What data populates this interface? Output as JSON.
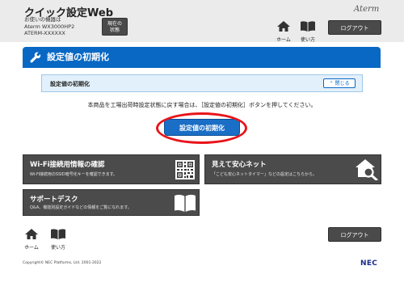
{
  "header": {
    "title": "クイック設定Web",
    "device_lines": [
      "お使いの機器は",
      "Aterm WX3000HP2",
      "ATERM-XXXXXX"
    ],
    "status_button": [
      "現在の",
      "状態"
    ],
    "brand": "Aterm",
    "home_label": "ホーム",
    "help_label": "使い方",
    "logout_label": "ログアウト"
  },
  "section": {
    "title": "設定値の初期化",
    "panel_title": "設定値の初期化",
    "collapse_label": "閉じる",
    "instruction": "本商品を工場出荷時設定状態に戻す場合は、［設定値の初期化］ボタンを押してください。",
    "action_button": "設定値の初期化"
  },
  "tiles": [
    {
      "title": "Wi-Fi接続用情報の確認",
      "desc": "Wi-Fi接続用のSSID暗号化キーを確認できます。",
      "icon": "qr-code-icon"
    },
    {
      "title": "見えて安心ネット",
      "desc": "「こども安心ネットタイマー」などの設定はこちらから。",
      "icon": "house-search-icon"
    },
    {
      "title": "サポートデスク",
      "desc": "Q&A、機能別設定ガイドなどの情報をご覧になれます。",
      "icon": "open-book-icon"
    }
  ],
  "footer": {
    "home_label": "ホーム",
    "help_label": "使い方",
    "logout_label": "ログアウト",
    "copyright": "Copyright© NEC Platforms, Ltd. 2001-2022",
    "logo": "NEC"
  },
  "colors": {
    "accent": "#0868c4",
    "tile": "#4b4b4b",
    "highlight": "#e8141a"
  }
}
